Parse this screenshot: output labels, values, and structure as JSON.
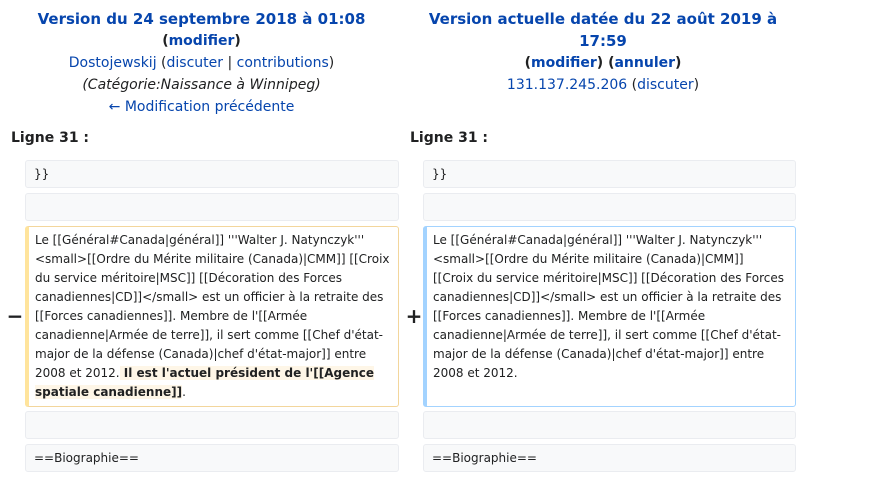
{
  "left": {
    "title": "Version du 24 septembre 2018 à 01:08",
    "edit_open": "(",
    "edit_label": "modifier",
    "edit_close": ")",
    "user": "Dostojewskij",
    "talk_open": " (",
    "talk_label": "discuter",
    "sep": " | ",
    "contribs_label": "contributions",
    "talk_close": ")",
    "summary": "(Catégorie:Naissance à Winnipeg)",
    "prev_edit": "← Modification précédente",
    "line_label": "Ligne 31 :"
  },
  "right": {
    "title": "Version actuelle datée du 22 août 2019 à 17:59",
    "edit_open": "(",
    "edit_label": "modifier",
    "mid": ") (",
    "undo_label": "annuler",
    "edit_close": ")",
    "user": "131.137.245.206",
    "talk_open": " (",
    "talk_label": "discuter",
    "talk_close": ")",
    "line_label": "Ligne 31 :"
  },
  "diff": {
    "context1": "}}",
    "context2": "",
    "deleted_text": "Le [[Général#Canada|général]] '''Walter J. Natynczyk''' <small>[[Ordre du Mérite militaire (Canada)|CMM]] [[Croix du service méritoire|MSC]] [[Décoration des Forces canadiennes|CD]]</small> est un officier à la retraite des [[Forces canadiennes]]. Membre de l'[[Armée canadienne|Armée de terre]], il sert comme [[Chef d'état-major de la défense (Canada)|chef d'état-major]] entre 2008 et 2012.",
    "deleted_highlight": " Il est l'actuel président de l'[[Agence spatiale canadienne]]",
    "deleted_tail": ".",
    "added_text": "Le [[Général#Canada|général]] '''Walter J. Natynczyk''' <small>[[Ordre du Mérite militaire (Canada)|CMM]] [[Croix du service méritoire|MSC]] [[Décoration des Forces canadiennes|CD]]</small> est un officier à la retraite des [[Forces canadiennes]]. Membre de l'[[Armée canadienne|Armée de terre]], il sert comme [[Chef d'état-major de la défense (Canada)|chef d'état-major]] entre 2008 et 2012.",
    "minus_marker": "−",
    "plus_marker": "+",
    "context3": "",
    "context4": "==Biographie=="
  },
  "colors": {
    "link": "#0645ad",
    "deleted_border": "#ffe49c",
    "added_border": "#a3d3ff",
    "context_bg": "#f8f9fa"
  }
}
